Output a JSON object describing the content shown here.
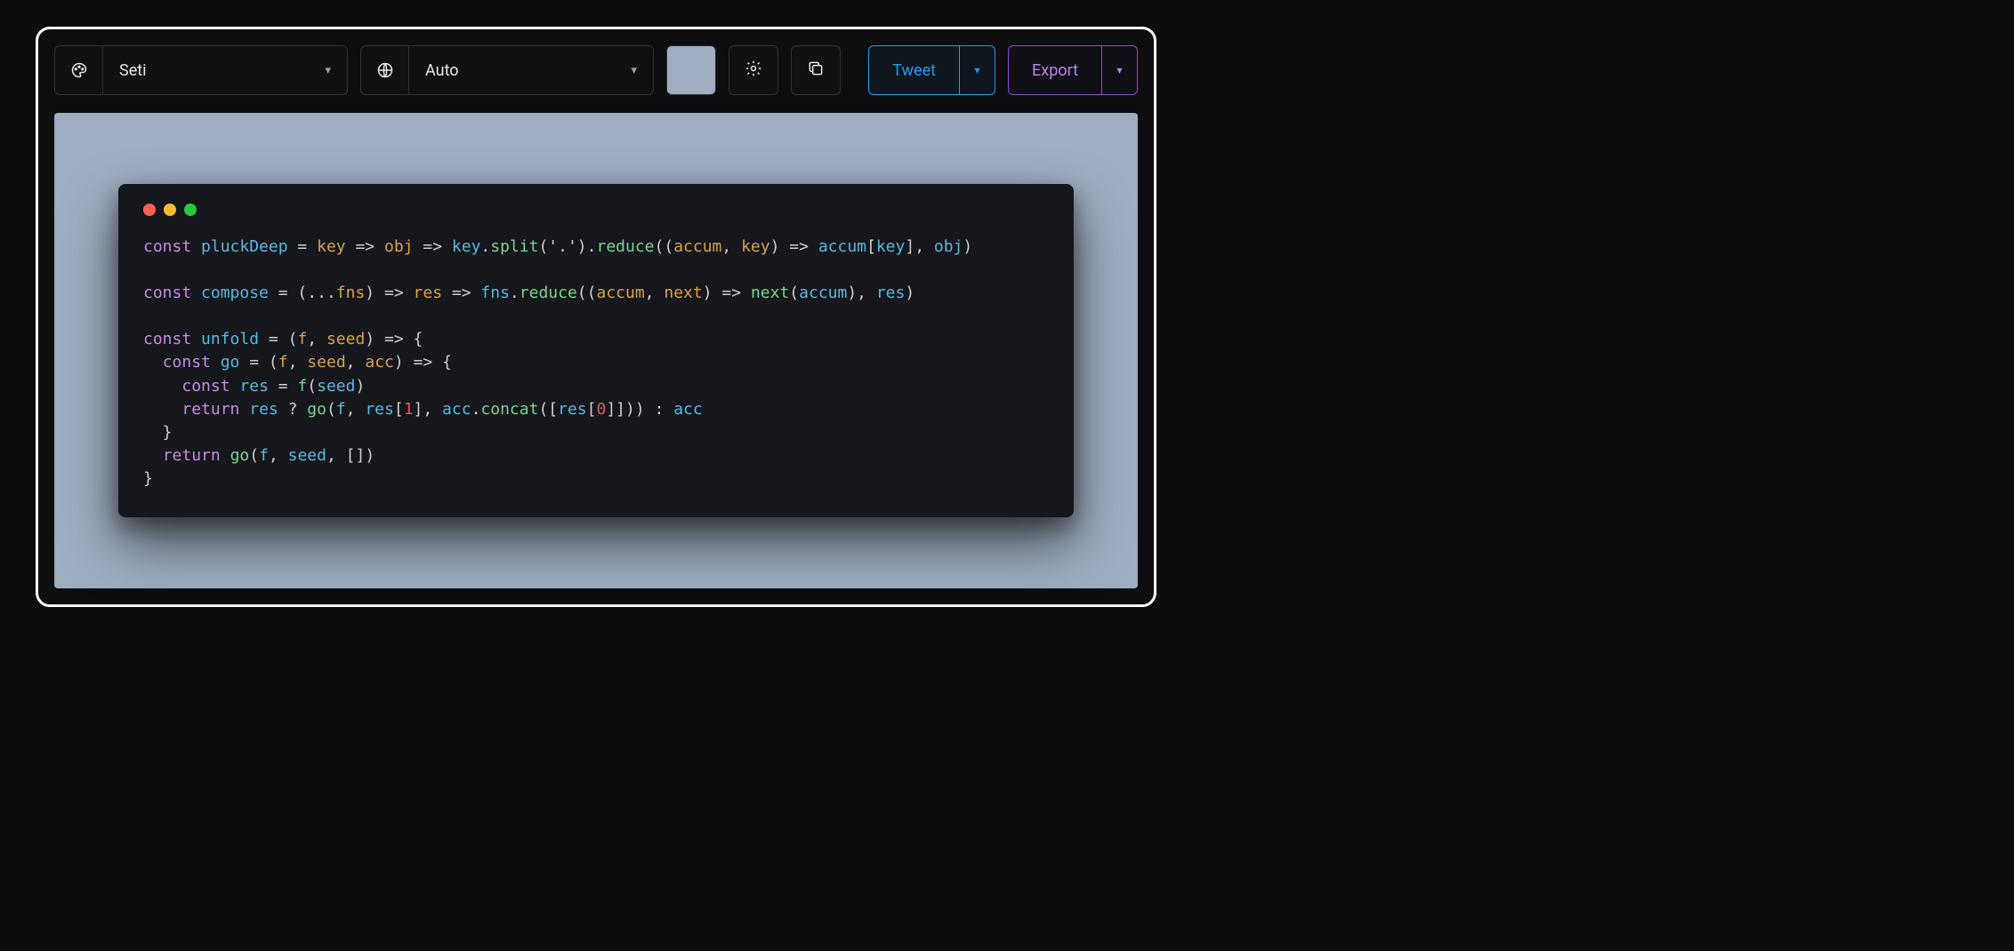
{
  "toolbar": {
    "theme_select": {
      "value": "Seti"
    },
    "language_select": {
      "value": "Auto"
    },
    "background_color": "#9eadc0",
    "tweet_label": "Tweet",
    "export_label": "Export"
  },
  "editor": {
    "window_controls": [
      "close",
      "minimize",
      "zoom"
    ],
    "language": "javascript",
    "tokens": [
      [
        [
          "k",
          "const"
        ],
        [
          "op",
          " "
        ],
        [
          "fn",
          "pluckDeep"
        ],
        [
          "op",
          " "
        ],
        [
          "op",
          "="
        ],
        [
          "op",
          " "
        ],
        [
          "pr",
          "key"
        ],
        [
          "op",
          " "
        ],
        [
          "op",
          "=>"
        ],
        [
          "op",
          " "
        ],
        [
          "pr",
          "obj"
        ],
        [
          "op",
          " "
        ],
        [
          "op",
          "=>"
        ],
        [
          "op",
          " "
        ],
        [
          "fn",
          "key"
        ],
        [
          "op",
          "."
        ],
        [
          "md",
          "split"
        ],
        [
          "op",
          "("
        ],
        [
          "st",
          "'.'"
        ],
        [
          "op",
          ")"
        ],
        [
          "op",
          "."
        ],
        [
          "md",
          "reduce"
        ],
        [
          "op",
          "(("
        ],
        [
          "pr",
          "accum"
        ],
        [
          "op",
          ", "
        ],
        [
          "pr",
          "key"
        ],
        [
          "op",
          ") "
        ],
        [
          "op",
          "=>"
        ],
        [
          "op",
          " "
        ],
        [
          "fn",
          "accum"
        ],
        [
          "op",
          "["
        ],
        [
          "fn",
          "key"
        ],
        [
          "op",
          "], "
        ],
        [
          "fn",
          "obj"
        ],
        [
          "op",
          ")"
        ]
      ],
      [],
      [
        [
          "k",
          "const"
        ],
        [
          "op",
          " "
        ],
        [
          "fn",
          "compose"
        ],
        [
          "op",
          " "
        ],
        [
          "op",
          "="
        ],
        [
          "op",
          " ("
        ],
        [
          "op",
          "..."
        ],
        [
          "pr",
          "fns"
        ],
        [
          "op",
          ") "
        ],
        [
          "op",
          "=>"
        ],
        [
          "op",
          " "
        ],
        [
          "pr",
          "res"
        ],
        [
          "op",
          " "
        ],
        [
          "op",
          "=>"
        ],
        [
          "op",
          " "
        ],
        [
          "fn",
          "fns"
        ],
        [
          "op",
          "."
        ],
        [
          "md",
          "reduce"
        ],
        [
          "op",
          "(("
        ],
        [
          "pr",
          "accum"
        ],
        [
          "op",
          ", "
        ],
        [
          "pr",
          "next"
        ],
        [
          "op",
          ") "
        ],
        [
          "op",
          "=>"
        ],
        [
          "op",
          " "
        ],
        [
          "md",
          "next"
        ],
        [
          "op",
          "("
        ],
        [
          "fn",
          "accum"
        ],
        [
          "op",
          "), "
        ],
        [
          "fn",
          "res"
        ],
        [
          "op",
          ")"
        ]
      ],
      [],
      [
        [
          "k",
          "const"
        ],
        [
          "op",
          " "
        ],
        [
          "fn",
          "unfold"
        ],
        [
          "op",
          " "
        ],
        [
          "op",
          "="
        ],
        [
          "op",
          " ("
        ],
        [
          "pr",
          "f"
        ],
        [
          "op",
          ", "
        ],
        [
          "pr",
          "seed"
        ],
        [
          "op",
          ") "
        ],
        [
          "op",
          "=>"
        ],
        [
          "op",
          " {"
        ]
      ],
      [
        [
          "op",
          "  "
        ],
        [
          "k",
          "const"
        ],
        [
          "op",
          " "
        ],
        [
          "fn",
          "go"
        ],
        [
          "op",
          " "
        ],
        [
          "op",
          "="
        ],
        [
          "op",
          " ("
        ],
        [
          "pr",
          "f"
        ],
        [
          "op",
          ", "
        ],
        [
          "pr",
          "seed"
        ],
        [
          "op",
          ", "
        ],
        [
          "pr",
          "acc"
        ],
        [
          "op",
          ") "
        ],
        [
          "op",
          "=>"
        ],
        [
          "op",
          " {"
        ]
      ],
      [
        [
          "op",
          "    "
        ],
        [
          "k",
          "const"
        ],
        [
          "op",
          " "
        ],
        [
          "fn",
          "res"
        ],
        [
          "op",
          " "
        ],
        [
          "op",
          "="
        ],
        [
          "op",
          " "
        ],
        [
          "md",
          "f"
        ],
        [
          "op",
          "("
        ],
        [
          "fn",
          "seed"
        ],
        [
          "op",
          ")"
        ]
      ],
      [
        [
          "op",
          "    "
        ],
        [
          "k",
          "return"
        ],
        [
          "op",
          " "
        ],
        [
          "fn",
          "res"
        ],
        [
          "op",
          " ? "
        ],
        [
          "md",
          "go"
        ],
        [
          "op",
          "("
        ],
        [
          "fn",
          "f"
        ],
        [
          "op",
          ", "
        ],
        [
          "fn",
          "res"
        ],
        [
          "op",
          "["
        ],
        [
          "nm",
          "1"
        ],
        [
          "op",
          "], "
        ],
        [
          "fn",
          "acc"
        ],
        [
          "op",
          "."
        ],
        [
          "md",
          "concat"
        ],
        [
          "op",
          "(["
        ],
        [
          "fn",
          "res"
        ],
        [
          "op",
          "["
        ],
        [
          "nm",
          "0"
        ],
        [
          "op",
          "]])) : "
        ],
        [
          "fn",
          "acc"
        ]
      ],
      [
        [
          "op",
          "  }"
        ]
      ],
      [
        [
          "op",
          "  "
        ],
        [
          "k",
          "return"
        ],
        [
          "op",
          " "
        ],
        [
          "md",
          "go"
        ],
        [
          "op",
          "("
        ],
        [
          "fn",
          "f"
        ],
        [
          "op",
          ", "
        ],
        [
          "fn",
          "seed"
        ],
        [
          "op",
          ", [])"
        ]
      ],
      [
        [
          "op",
          "}"
        ]
      ]
    ]
  }
}
